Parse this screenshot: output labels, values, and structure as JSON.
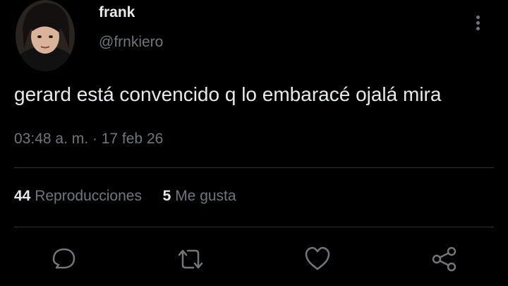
{
  "user": {
    "display_name": "frank",
    "handle": "@frnkiero"
  },
  "tweet": {
    "text": "gerard está convencido q lo embaracé ojalá mira",
    "timestamp": "03:48 a. m. · 17 feb 26"
  },
  "stats": {
    "views_count": "44",
    "views_label": "Reproducciones",
    "likes_count": "5",
    "likes_label": "Me gusta"
  },
  "colors": {
    "background": "#000000",
    "text_primary": "#e7e9ea",
    "text_secondary": "#71767b",
    "divider": "#2f3336"
  },
  "icons": {
    "more": "more-vertical-icon",
    "reply": "reply-bubble-icon",
    "retweet": "retweet-icon",
    "like": "heart-icon",
    "share": "share-icon"
  }
}
